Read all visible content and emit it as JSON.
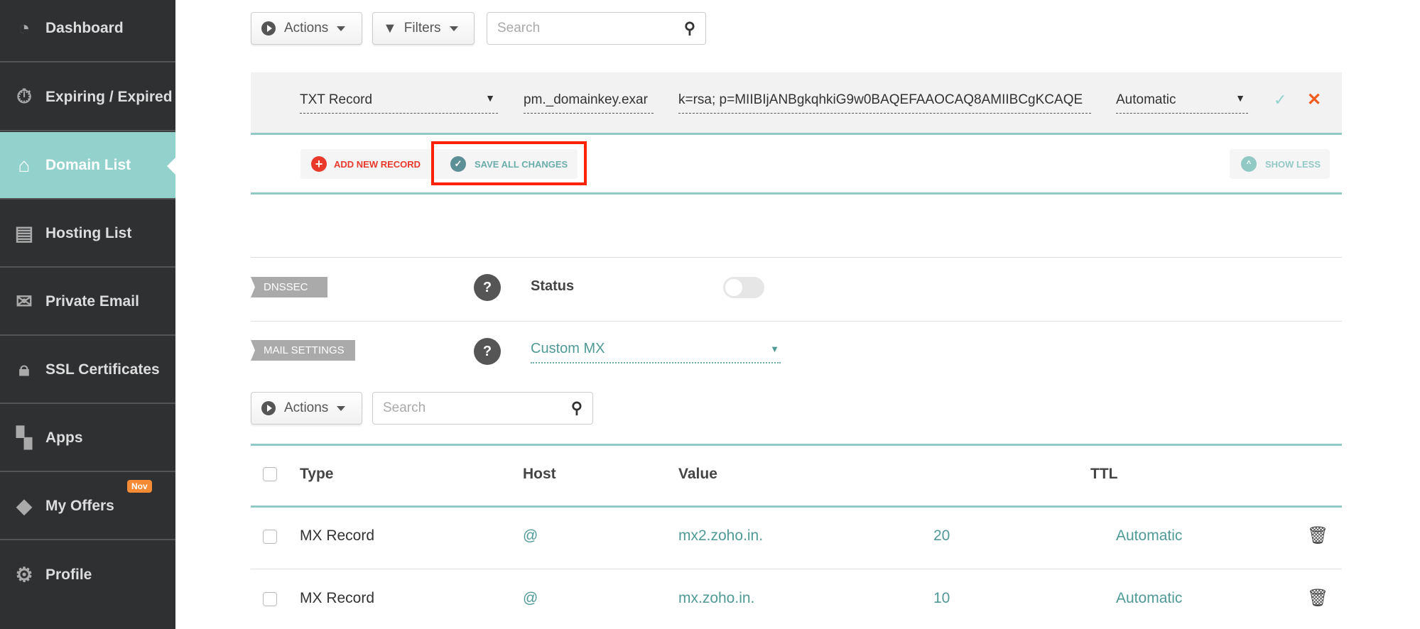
{
  "sidebar": {
    "items": [
      {
        "label": "Dashboard",
        "icon": "gauge-icon"
      },
      {
        "label": "Expiring / Expired",
        "icon": "stopwatch-icon"
      },
      {
        "label": "Domain List",
        "icon": "home-icon",
        "active": true
      },
      {
        "label": "Hosting List",
        "icon": "server-icon"
      },
      {
        "label": "Private Email",
        "icon": "envelope-icon"
      },
      {
        "label": "SSL Certificates",
        "icon": "lock-icon"
      },
      {
        "label": "Apps",
        "icon": "apps-icon"
      },
      {
        "label": "My Offers",
        "icon": "tag-icon",
        "badge": "Nov"
      },
      {
        "label": "Profile",
        "icon": "gear-icon"
      }
    ]
  },
  "toolbar": {
    "actions": "Actions",
    "filters": "Filters",
    "search_placeholder": "Search"
  },
  "edit_row": {
    "type": "TXT Record",
    "host": "pm._domainkey.exar",
    "value": "k=rsa; p=MIIBIjANBgkqhkiG9w0BAQEFAAOCAQ8AMIIBCgKCAQE",
    "ttl": "Automatic"
  },
  "record_actions": {
    "add": "ADD NEW RECORD",
    "save": "SAVE ALL CHANGES",
    "show_less": "SHOW LESS"
  },
  "dnssec": {
    "tag": "DNSSEC",
    "status_label": "Status",
    "enabled": false
  },
  "mail": {
    "tag": "MAIL SETTINGS",
    "selected": "Custom MX"
  },
  "mx_toolbar": {
    "actions": "Actions",
    "search_placeholder": "Search"
  },
  "table": {
    "headers": {
      "type": "Type",
      "host": "Host",
      "value": "Value",
      "ttl": "TTL"
    },
    "rows": [
      {
        "type": "MX Record",
        "host": "@",
        "value": "mx2.zoho.in.",
        "priority": "20",
        "ttl": "Automatic"
      },
      {
        "type": "MX Record",
        "host": "@",
        "value": "mx.zoho.in.",
        "priority": "10",
        "ttl": "Automatic"
      }
    ]
  },
  "colors": {
    "accent": "#93d1cd",
    "highlight": "#ff2200",
    "danger": "#e8392b"
  }
}
